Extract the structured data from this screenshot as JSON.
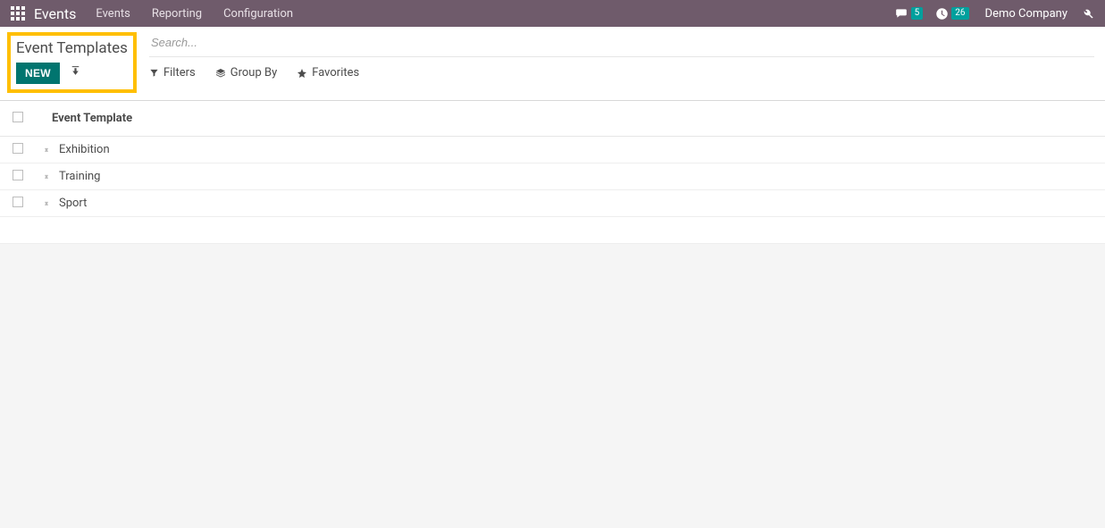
{
  "navbar": {
    "brand": "Events",
    "menu": [
      "Events",
      "Reporting",
      "Configuration"
    ],
    "messages_count": "5",
    "activities_count": "26",
    "company": "Demo Company"
  },
  "control": {
    "breadcrumb": "Event Templates",
    "new_label": "NEW",
    "search_placeholder": "Search...",
    "filters_label": "Filters",
    "groupby_label": "Group By",
    "favorites_label": "Favorites"
  },
  "list": {
    "header": "Event Template",
    "rows": [
      {
        "name": "Exhibition"
      },
      {
        "name": "Training"
      },
      {
        "name": "Sport"
      }
    ]
  }
}
